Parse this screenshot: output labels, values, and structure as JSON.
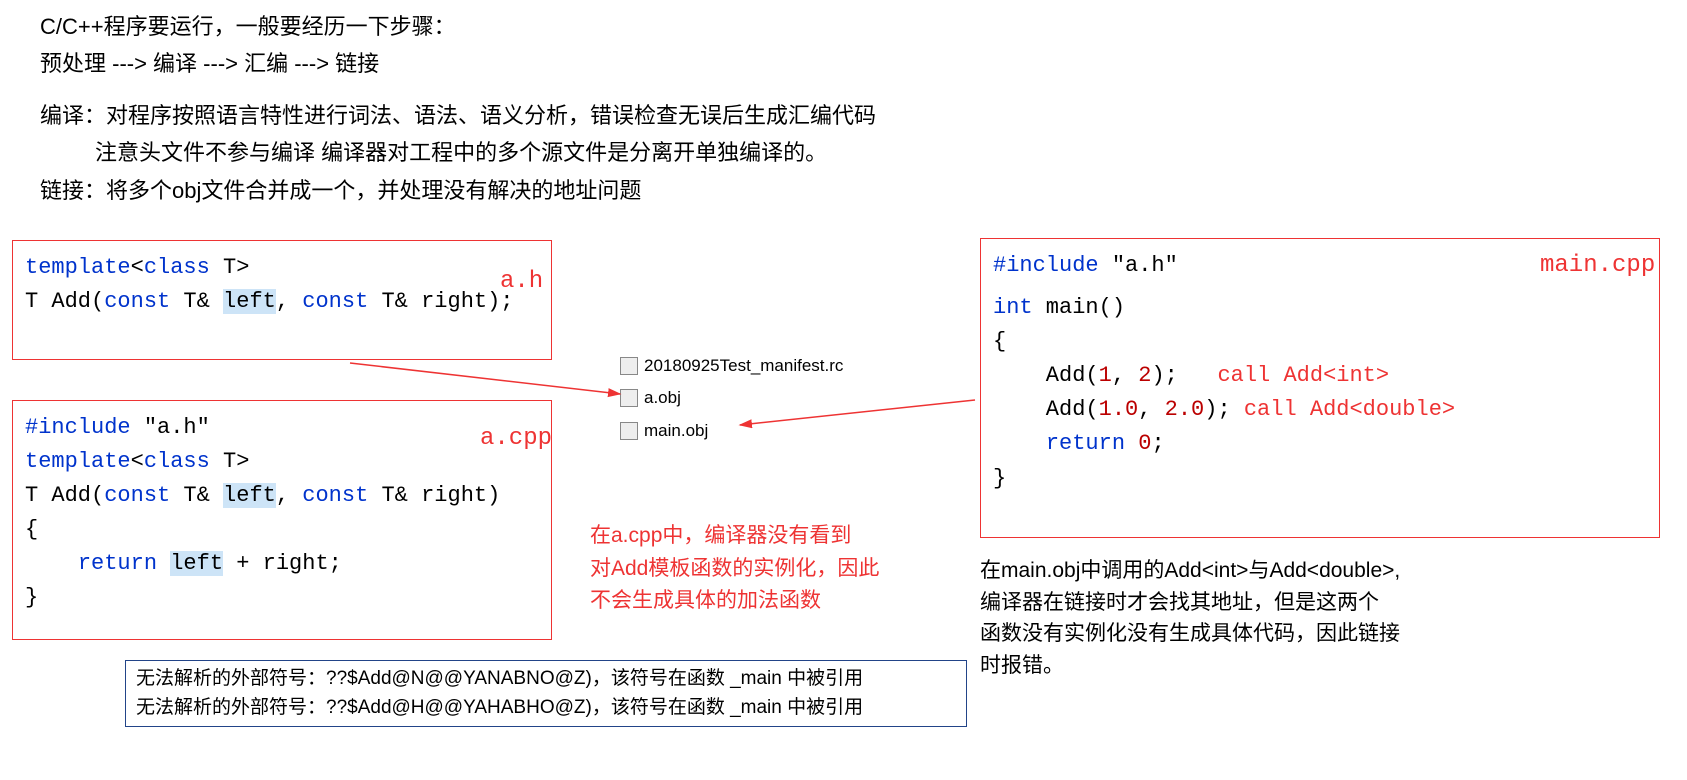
{
  "intro": {
    "l1": "C/C++程序要运行，一般要经历一下步骤：",
    "l2": "预处理 ---> 编译 ---> 汇编 ---> 链接",
    "l3": "编译：对程序按照语言特性进行词法、语法、语义分析，错误检查无误后生成汇编代码",
    "l4": "注意头文件不参与编译  编译器对工程中的多个源文件是分离开单独编译的。",
    "l5": "链接：将多个obj文件合并成一个，并处理没有解决的地址问题"
  },
  "box_ah": {
    "label": "a.h",
    "line1_pre": "template",
    "line1_lt": "<",
    "line1_class": "class",
    "line1_T": " T",
    "line1_gt": ">",
    "line2_T": "T ",
    "line2_Add": "Add",
    "line2_lp": "(",
    "line2_const1": "const",
    "line2_amp1": " T& ",
    "line2_left": "left",
    "line2_comma": ", ",
    "line2_const2": "const",
    "line2_amp2": " T& right);"
  },
  "box_acpp": {
    "label": "a.cpp",
    "inc": "#include",
    "inc_str": " \"a.h\"",
    "tpl": "template",
    "lt": "<",
    "cls": "class",
    "T": " T",
    "gt": ">",
    "sig_T": "T ",
    "sig_Add": "Add",
    "sig_lp": "(",
    "sig_const1": "const",
    "sig_amp1": " T& ",
    "sig_left": "left",
    "sig_comma": ", ",
    "sig_const2": "const",
    "sig_amp2": " T& right)",
    "lb": "{",
    "ret_kw": "return",
    "ret_sp": " ",
    "ret_left": "left",
    "ret_rest": " + right;",
    "rb": "}"
  },
  "box_main": {
    "label": "main.cpp",
    "inc": "#include",
    "inc_str": " \"a.h\"",
    "int": "int",
    "main": " main()",
    "lb": "{",
    "call1_pre": "    Add(",
    "call1_a": "1",
    "call1_m": ", ",
    "call1_b": "2",
    "call1_post": ");",
    "call1_note": "call Add<int>",
    "call2_pre": "    Add(",
    "call2_a": "1.0",
    "call2_m": ", ",
    "call2_b": "2.0",
    "call2_post": ");",
    "call2_note": "call Add<double>",
    "ret_kw": "return",
    "ret_rest": " ",
    "ret_zero": "0",
    "ret_semi": ";",
    "rb": "}"
  },
  "files": {
    "f1": "20180925Test_manifest.rc",
    "f2": "a.obj",
    "f3": "main.obj"
  },
  "annot_left": {
    "l1": "在a.cpp中，编译器没有看到",
    "l2": "对Add模板函数的实例化，因此",
    "l3": "不会生成具体的加法函数"
  },
  "annot_right": {
    "l1": "在main.obj中调用的Add<int>与Add<double>,",
    "l2": "编译器在链接时才会找其地址，但是这两个",
    "l3": "函数没有实例化没有生成具体代码，因此链接",
    "l4": "时报错。"
  },
  "errors": {
    "e1": "无法解析的外部符号：??$Add@N@@YANABNO@Z)，该符号在函数 _main 中被引用",
    "e2": "无法解析的外部符号：??$Add@H@@YAHABHO@Z)，该符号在函数 _main 中被引用"
  }
}
